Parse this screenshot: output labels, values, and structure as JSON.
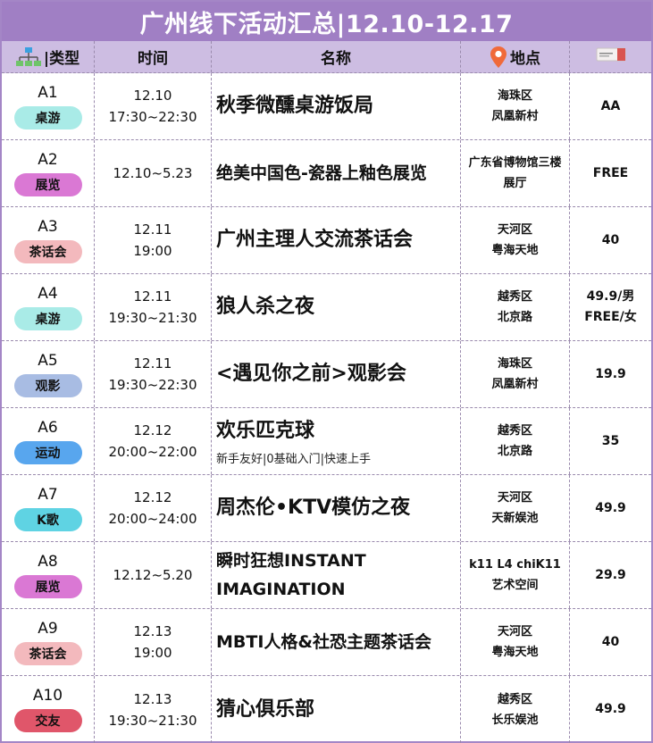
{
  "title": "广州线下活动汇总|12.10-12.17",
  "headers": {
    "type": "|类型",
    "time": "时间",
    "name": "名称",
    "place": "地点"
  },
  "icons": {
    "type": "org-chart-icon",
    "place": "location-pin-icon",
    "price": "ticket-icon"
  },
  "colors": {
    "title_bg": "#a07fc4",
    "header_bg": "#cdbde2",
    "tag_teal": "#a9ebe7",
    "tag_purple": "#da78d4",
    "tag_pink": "#f3b9bd",
    "tag_blue_gray": "#a8bce3",
    "tag_blue": "#58a6ee",
    "tag_cyan": "#5fd3e3",
    "tag_red": "#e0566a"
  },
  "rows": [
    {
      "code": "A1",
      "tag": "桌游",
      "tag_color": "#a9ebe7",
      "time1": "12.10",
      "time2": "17:30~22:30",
      "name": "秋季微醺桌游饭局",
      "sub": "",
      "place1": "海珠区",
      "place2": "凤凰新村",
      "price1": "AA",
      "price2": ""
    },
    {
      "code": "A2",
      "tag": "展览",
      "tag_color": "#da78d4",
      "time1": "12.10~5.23",
      "time2": "",
      "name": "绝美中国色-瓷器上釉色展览",
      "sub": "",
      "place1": "广东省博物馆三楼",
      "place2": "展厅",
      "price1": "FREE",
      "price2": ""
    },
    {
      "code": "A3",
      "tag": "茶话会",
      "tag_color": "#f3b9bd",
      "time1": "12.11",
      "time2": "19:00",
      "name": "广州主理人交流茶话会",
      "sub": "",
      "place1": "天河区",
      "place2": "粤海天地",
      "price1": "40",
      "price2": ""
    },
    {
      "code": "A4",
      "tag": "桌游",
      "tag_color": "#a9ebe7",
      "time1": "12.11",
      "time2": "19:30~21:30",
      "name": "狼人杀之夜",
      "sub": "",
      "place1": "越秀区",
      "place2": "北京路",
      "price1": "49.9/男",
      "price2": "FREE/女"
    },
    {
      "code": "A5",
      "tag": "观影",
      "tag_color": "#a8bce3",
      "time1": "12.11",
      "time2": "19:30~22:30",
      "name": "<遇见你之前>观影会",
      "sub": "",
      "place1": "海珠区",
      "place2": "凤凰新村",
      "price1": "19.9",
      "price2": ""
    },
    {
      "code": "A6",
      "tag": "运动",
      "tag_color": "#58a6ee",
      "time1": "12.12",
      "time2": "20:00~22:00",
      "name": "欢乐匹克球",
      "sub": "新手友好|0基础入门|快速上手",
      "place1": "越秀区",
      "place2": "北京路",
      "price1": "35",
      "price2": ""
    },
    {
      "code": "A7",
      "tag": "K歌",
      "tag_color": "#5fd3e3",
      "time1": "12.12",
      "time2": "20:00~24:00",
      "name": "周杰伦•KTV模仿之夜",
      "sub": "",
      "place1": "天河区",
      "place2": "天新娱池",
      "price1": "49.9",
      "price2": ""
    },
    {
      "code": "A8",
      "tag": "展览",
      "tag_color": "#da78d4",
      "time1": "12.12~5.20",
      "time2": "",
      "name": "瞬时狂想INSTANT IMAGINATION",
      "sub": "",
      "place1": "k11 L4 chiK11",
      "place2": "艺术空间",
      "price1": "29.9",
      "price2": ""
    },
    {
      "code": "A9",
      "tag": "茶话会",
      "tag_color": "#f3b9bd",
      "time1": "12.13",
      "time2": "19:00",
      "name": "MBTI人格&社恐主题茶话会",
      "sub": "",
      "place1": "天河区",
      "place2": "粤海天地",
      "price1": "40",
      "price2": ""
    },
    {
      "code": "A10",
      "tag": "交友",
      "tag_color": "#e0566a",
      "time1": "12.13",
      "time2": "19:30~21:30",
      "name": "猜心俱乐部",
      "sub": "",
      "place1": "越秀区",
      "place2": "长乐娱池",
      "price1": "49.9",
      "price2": ""
    }
  ]
}
